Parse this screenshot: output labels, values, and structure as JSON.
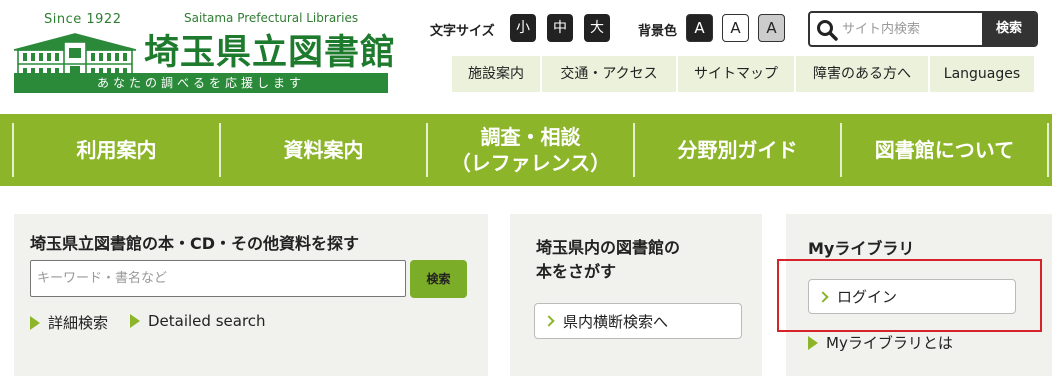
{
  "logo": {
    "since": "Since 1922",
    "english_name": "Saitama Prefectural Libraries",
    "japanese_name": "埼玉県立図書館",
    "tagline": "あなたの調べるを応援します"
  },
  "controls": {
    "font_size_label": "文字サイズ",
    "font_sizes": [
      "小",
      "中",
      "大"
    ],
    "bg_color_label": "背景色",
    "bg_colors": [
      "A",
      "A",
      "A"
    ]
  },
  "search": {
    "placeholder": "サイト内検索",
    "button": "検索"
  },
  "subnav": [
    "施設案内",
    "交通・アクセス",
    "サイトマップ",
    "障害のある方へ",
    "Languages"
  ],
  "mainnav": [
    "利用案内",
    "資料案内",
    "調査・相談\n（レファレンス）",
    "分野別ガイド",
    "図書館について"
  ],
  "panel_search": {
    "title": "埼玉県立図書館の本・CD・その他資料を探す",
    "placeholder": "キーワード・書名など",
    "button": "検索",
    "links": [
      "詳細検索",
      "Detailed search"
    ]
  },
  "panel_prefecture": {
    "title_line1": "埼玉県内の図書館の",
    "title_line2": "本をさがす",
    "button": "県内横断検索へ"
  },
  "panel_mylibrary": {
    "title": "Myライブラリ",
    "login": "ログイン",
    "about": "Myライブラリとは"
  },
  "colors": {
    "accent_green": "#8cb52a",
    "logo_green": "#1e7b2e",
    "highlight_red": "#d6232a",
    "subnav_bg": "#ecf1dc",
    "panel_bg": "#f1f1ed"
  }
}
